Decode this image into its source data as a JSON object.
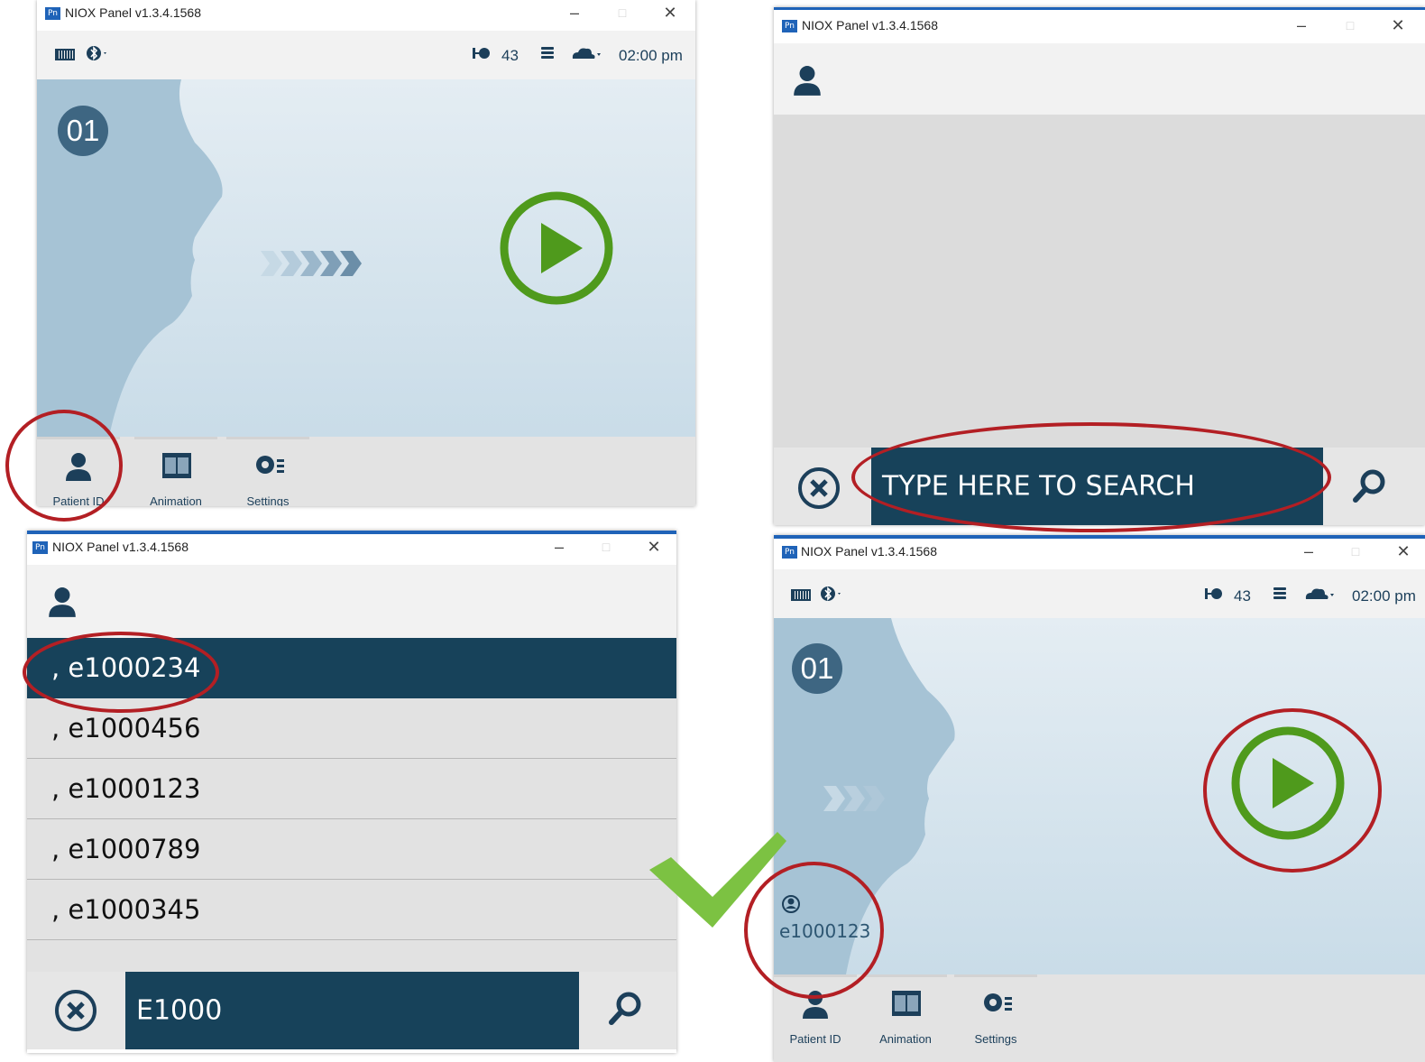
{
  "window_title": "NIOX Panel v1.3.4.1568",
  "app_icon_text": "Pn",
  "window_controls": {
    "minimize": "–",
    "maximize": "□",
    "close": "✕"
  },
  "status": {
    "bluetooth_icon": "bluetooth-icon",
    "counter": "43",
    "time": "02:00 pm",
    "time_partial": "02:00 pm"
  },
  "measurement": {
    "step_number": "01"
  },
  "toolbar": {
    "patient_id": "Patient ID",
    "animation": "Animation",
    "settings": "Settings"
  },
  "search": {
    "placeholder": "TYPE HERE TO SEARCH",
    "query": "E1000"
  },
  "results": [
    ", e1000234",
    ", e1000456",
    ", e1000123",
    ", e1000789",
    ", e1000345"
  ],
  "selected_patient": {
    "id": "e1000123"
  },
  "colors": {
    "dark_teal": "#17425a",
    "play_green": "#4f9a1c",
    "annotation_red": "#b31f24",
    "check_green": "#7cc242"
  }
}
